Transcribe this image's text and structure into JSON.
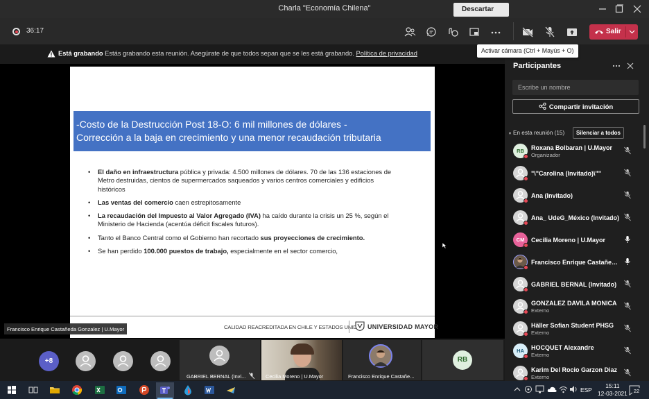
{
  "window": {
    "title": "Charla \"Economía Chilena\""
  },
  "toolbar": {
    "timer": "36:17",
    "leave_label": "Salir"
  },
  "banner": {
    "bold": "Está grabando",
    "text": " Estás grabando esta reunión. Asegúrate de que todos sepan que se les está grabando. ",
    "link": "Política de privacidad",
    "dismiss_label": "Descartar"
  },
  "tooltip": "Activar cámara (Ctrl + Mayús + O)",
  "slide": {
    "title_line1": "-Costo de la Destrucción Post 18-O: 6 mil millones de dólares  -",
    "title_line2": "Corrección a la baja en crecimiento y una menor recaudación tributaria",
    "bullets": [
      {
        "bold": "El daño en infraestructura",
        "text": " pública y privada: 4.500 millones de dólares. 70 de las 136 estaciones de Metro destruidas, cientos de supermercados saqueados y varios centros comerciales y edificios históricos"
      },
      {
        "bold": "Las ventas del comercio",
        "text": " caen estrepitosamente"
      },
      {
        "bold": " La recaudación del Impuesto al Valor Agregado (IVA)",
        "text": " ha caído durante la crisis un 25 %, según el Ministerio de Hacienda (acentúa déficit fiscales futuros)."
      },
      {
        "pre": "Tanto el Banco Central como el Gobierno han recortado ",
        "bold": "sus proyecciones de crecimiento.",
        "text": ""
      },
      {
        "pre": "Se han perdido ",
        "bold": "100.000 puestos de trabajo,",
        "text": " especialmente en el sector comercio,"
      }
    ],
    "footer_accreditation": "CALIDAD REACREDITADA EN CHILE Y ESTADOS UNIDOS",
    "footer_university": "UNIVERSIDAD MAYOR"
  },
  "presenter_label": "Francisco Enrique Castañeda Gonzalez | U.Mayor",
  "participants": {
    "title": "Participantes",
    "search_placeholder": "Escribe un nombre",
    "share_label": "Compartir invitación",
    "section_label": "En esta reunión (15)",
    "mute_all_label": "Silenciar a todos",
    "list": [
      {
        "name": "Roxana Bolbaran | U.Mayor",
        "sub": "Organizador",
        "initials": "RB",
        "avatar_color": "#e0f0e0",
        "avatar_text": "#2d6a2d",
        "mic": "muted"
      },
      {
        "name": "\"\\\"Carolina (Invitado)\\\"\"",
        "sub": "",
        "initials": "",
        "avatar_color": "#d6d6d6",
        "avatar_text": "#666",
        "mic": "muted"
      },
      {
        "name": "Ana (Invitado)",
        "sub": "",
        "initials": "",
        "avatar_color": "#d6d6d6",
        "avatar_text": "#666",
        "mic": "muted"
      },
      {
        "name": "Ana_ UdeG_México (Invitado)",
        "sub": "",
        "initials": "",
        "avatar_color": "#d6d6d6",
        "avatar_text": "#666",
        "mic": "muted"
      },
      {
        "name": "Cecilia Moreno | U.Mayor",
        "sub": "",
        "initials": "CM",
        "avatar_color": "#e8629a",
        "avatar_text": "#fff",
        "mic": "on"
      },
      {
        "name": "Francisco Enrique Castañeda ...",
        "sub": "",
        "initials": "",
        "avatar_color": "#6b5a4a",
        "avatar_text": "#fff",
        "mic": "on",
        "photo": true
      },
      {
        "name": "GABRIEL BERNAL (Invitado)",
        "sub": "",
        "initials": "",
        "avatar_color": "#d6d6d6",
        "avatar_text": "#666",
        "mic": "muted"
      },
      {
        "name": "GONZALEZ DAVILA MONICA",
        "sub": "Externo",
        "initials": "",
        "avatar_color": "#d6d6d6",
        "avatar_text": "#666",
        "mic": "muted"
      },
      {
        "name": "Häller Sofian Student PHSG",
        "sub": "Externo",
        "initials": "",
        "avatar_color": "#d6d6d6",
        "avatar_text": "#666",
        "mic": "muted"
      },
      {
        "name": "HOCQUET Alexandre",
        "sub": "Externo",
        "initials": "HA",
        "avatar_color": "#d8eef8",
        "avatar_text": "#1d5b7a",
        "mic": "muted"
      },
      {
        "name": "Karim Del Rocio Garzon Diaz",
        "sub": "Externo",
        "initials": "",
        "avatar_color": "#d6d6d6",
        "avatar_text": "#666",
        "mic": "muted"
      }
    ]
  },
  "strip": {
    "more_count": "+8",
    "tiles": [
      {
        "name": "GABRIEL BERNAL (Invi..."
      },
      {
        "name": "Cecilia Moreno | U.Mayor"
      },
      {
        "name": "Francisco Enrique Castañe..."
      },
      {
        "initials": "RB"
      }
    ]
  },
  "taskbar": {
    "lang": "ESP",
    "time": "15:11",
    "date": "12-03-2021",
    "notifications": "22"
  }
}
